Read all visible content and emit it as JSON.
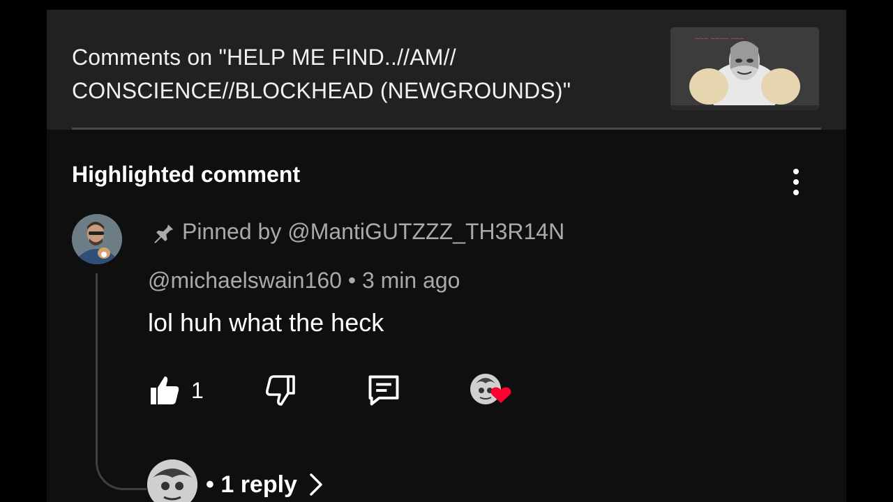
{
  "header": {
    "title": "Comments on \"HELP ME FIND..//AM// CONSCIENCE//BLOCKHEAD (NEWGROUNDS)\"",
    "thumbnail_icon": "video-thumbnail"
  },
  "section": {
    "title": "Highlighted comment",
    "menu_icon": "more-vertical-icon"
  },
  "comment": {
    "pinned_label": "Pinned by @MantiGUTZZZ_TH3R14N",
    "author": "@michaelswain160",
    "separator": "•",
    "time": "3 min ago",
    "meta": "@michaelswain160 • 3 min ago",
    "text": "lol huh what the heck",
    "likes": "1",
    "liked": true,
    "creator_heart": true
  },
  "replies": {
    "label": "• 1 reply"
  },
  "colors": {
    "background": "#0f0f0f",
    "header_bg": "#212121",
    "secondary_text": "#aaaaaa",
    "heart": "#ff0033"
  }
}
